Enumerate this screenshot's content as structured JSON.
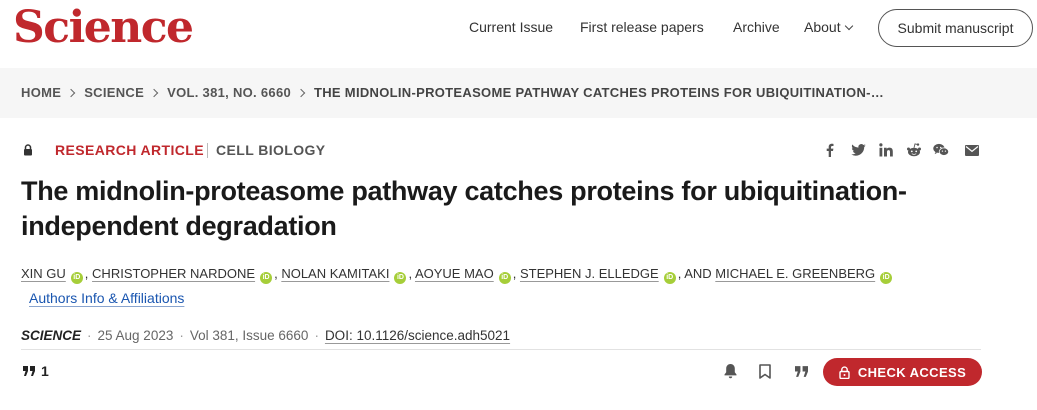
{
  "header": {
    "logo": "Science",
    "nav": {
      "current_issue": "Current Issue",
      "first_release": "First release papers",
      "archive": "Archive",
      "about": "About"
    },
    "submit_label": "Submit manuscript"
  },
  "breadcrumb": [
    "HOME",
    "SCIENCE",
    "VOL. 381, NO. 6660",
    "THE MIDNOLIN-PROTEASOME PATHWAY CATCHES PROTEINS FOR UBIQUITINATION-…"
  ],
  "article": {
    "type": "RESEARCH ARTICLE",
    "subject": "CELL BIOLOGY",
    "title": "The midnolin-proteasome pathway catches proteins for ubiquitination-independent degradation",
    "authors": [
      "XIN GU",
      "CHRISTOPHER NARDONE",
      "NOLAN KAMITAKI",
      "AOYUE MAO",
      "STEPHEN J. ELLEDGE",
      "MICHAEL E. GREENBERG"
    ],
    "author_separator": ",",
    "author_last_joiner": ", AND",
    "orcid_label": "iD",
    "affiliations_link": "Authors Info & Affiliations",
    "journal": "SCIENCE",
    "date": "25 Aug 2023",
    "volume_issue": "Vol 381, Issue 6660",
    "doi": "DOI: 10.1126/science.adh5021",
    "citation_count": "1"
  },
  "share_icons": [
    "facebook-icon",
    "twitter-icon",
    "linkedin-icon",
    "reddit-icon",
    "wechat-icon",
    "email-icon"
  ],
  "actions": {
    "check_access": "CHECK ACCESS"
  },
  "colors": {
    "brand_red": "#c0282d",
    "link_blue": "#1a56b0",
    "orcid_green": "#a6ce39"
  }
}
